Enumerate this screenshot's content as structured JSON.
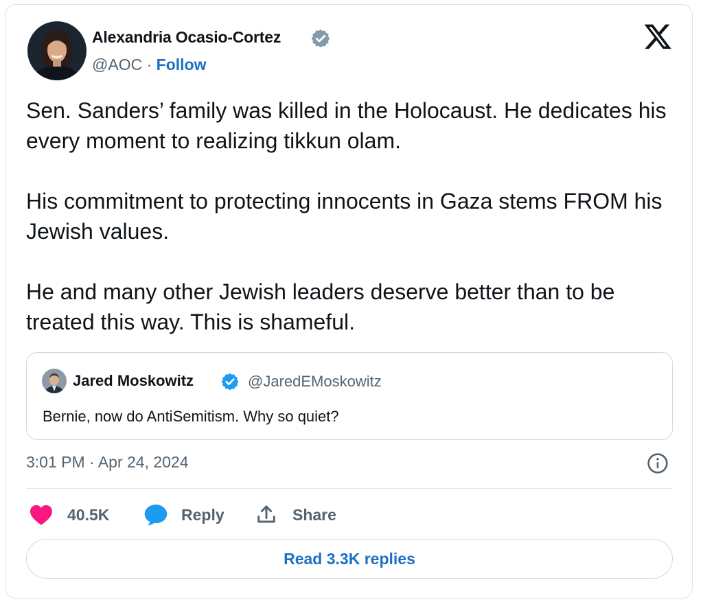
{
  "author": {
    "name": "Alexandria Ocasio-Cortez",
    "handle": "@AOC",
    "separator": "·",
    "follow_label": "Follow"
  },
  "tweet": {
    "paragraphs": [
      "Sen. Sanders’ family was killed in the Holocaust. He dedicates his every moment to realizing tikkun olam.",
      "His commitment to protecting innocents in Gaza stems FROM his Jewish values.",
      "He and many other Jewish leaders deserve better than to be treated this way. This is shameful."
    ],
    "timestamp": "3:01 PM · Apr 24, 2024"
  },
  "quoted_tweet": {
    "name": "Jared Moskowitz",
    "handle": "@JaredEMoskowitz",
    "text": "Bernie, now do AntiSemitism. Why so quiet?"
  },
  "actions": {
    "likes": "40.5K",
    "reply_label": "Reply",
    "share_label": "Share",
    "read_replies_label": "Read 3.3K replies"
  },
  "icons": {
    "verified": "verified-badge-icon",
    "x_logo": "x-logo-icon",
    "info": "info-icon",
    "like": "heart-icon",
    "reply": "speech-bubble-icon",
    "share": "share-icon"
  },
  "colors": {
    "link_blue": "#1d70c4",
    "verified_gray": "#829aab",
    "verified_blue": "#1d9bf0",
    "like_pink": "#f91880",
    "reply_blue": "#1d9bf0",
    "muted_text": "#536471"
  }
}
